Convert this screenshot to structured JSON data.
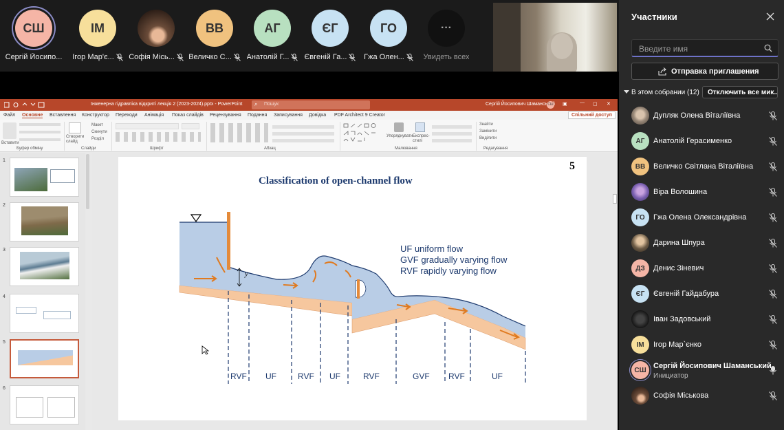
{
  "strip": {
    "tiles": [
      {
        "initials": "СШ",
        "name": "Сергій Йосипо...",
        "bg": "#f5b5a6",
        "muted": false,
        "ring": true
      },
      {
        "initials": "ІМ",
        "name": "Ігор Мар'є...",
        "bg": "#f7df9b",
        "muted": true
      },
      {
        "initials": "",
        "name": "Софія Місь...",
        "bg": "#6b4c39",
        "muted": true,
        "photo": true
      },
      {
        "initials": "ВВ",
        "name": "Величко С...",
        "bg": "#f0c27f",
        "muted": true
      },
      {
        "initials": "АГ",
        "name": "Анатолій Г...",
        "bg": "#b8e0c0",
        "muted": true
      },
      {
        "initials": "ЄГ",
        "name": "Євгеній Га...",
        "bg": "#c7e2f3",
        "muted": true
      },
      {
        "initials": "ГО",
        "name": "Гжа Олен...",
        "bg": "#c7e2f3",
        "muted": true
      }
    ],
    "more_icon": "more-icon",
    "more_label": "Увидеть всех"
  },
  "ppt": {
    "title_file": "Інженерна гідравліка відкриті лекція 2 (2023-2024).pptx  -  PowerPoint",
    "search_placeholder": "Пошук",
    "user_name": "Сергій Йосипович Шаманський",
    "user_initials": "СШ",
    "share_label": "Спільний доступ",
    "menu": [
      "Файл",
      "Основне",
      "Вставлення",
      "Конструктор",
      "Переходи",
      "Анімація",
      "Показ слайдів",
      "Рецензування",
      "Подання",
      "Записування",
      "Довідка",
      "PDF Architect 9 Creator"
    ],
    "ribbon_groups": [
      "Буфер обміну",
      "Слайди",
      "Шрифт",
      "Абзац",
      "Малювання",
      "Редагування"
    ],
    "ribbon_items": {
      "paste": "Вставити",
      "new_slide": "Створити слайд",
      "layout": "Макет",
      "reset": "Скинути",
      "section": "Розділ",
      "arrange": "Упорядкувати",
      "styles": "Експрес-стилі",
      "find": "Знайти",
      "replace": "Замінити",
      "select": "Виділити"
    },
    "thumb_numbers": [
      "1",
      "2",
      "3",
      "4",
      "5",
      "6"
    ]
  },
  "slide": {
    "number": "5",
    "title": "Classification of open-channel flow",
    "legend": [
      "UF uniform flow",
      "GVF gradually varying flow",
      "RVF rapidly varying flow"
    ],
    "depth_label": "y",
    "zones": [
      "RVF",
      "UF",
      "RVF",
      "UF",
      "RVF",
      "GVF",
      "RVF",
      "UF"
    ]
  },
  "panel": {
    "title": "Участники",
    "search_placeholder": "Введите имя",
    "invite_label": "Отправка приглашения",
    "section_label": "В этом собрании (12)",
    "mute_all_label": "Отключить все мик...",
    "participants": [
      {
        "initials": "",
        "name": "Дупляк Олена Віталіївна",
        "bg": "#9a8a7a",
        "photo": true,
        "muted": true
      },
      {
        "initials": "АГ",
        "name": "Анатолій Герасименко",
        "bg": "#b8e0c0",
        "muted": true
      },
      {
        "initials": "ВВ",
        "name": "Величко Світлана Віталіївна",
        "bg": "#f0c27f",
        "muted": true
      },
      {
        "initials": "",
        "name": "Віра Волошина",
        "bg": "#7a5fb0",
        "photo": true,
        "muted": true
      },
      {
        "initials": "ГО",
        "name": "Гжа Олена Олександрівна",
        "bg": "#c7e2f3",
        "muted": true
      },
      {
        "initials": "",
        "name": "Дарина Шпура",
        "bg": "#6b5a45",
        "photo": true,
        "muted": true
      },
      {
        "initials": "ДЗ",
        "name": "Денис Зіневич",
        "bg": "#f5b5a6",
        "muted": true
      },
      {
        "initials": "ЄГ",
        "name": "Євгеній Гайдабура",
        "bg": "#c7e2f3",
        "muted": true
      },
      {
        "initials": "",
        "name": "Іван Задовський",
        "bg": "#222222",
        "photo": true,
        "muted": true
      },
      {
        "initials": "ІМ",
        "name": "Ігор Мар`єнко",
        "bg": "#f7df9b",
        "muted": true
      },
      {
        "initials": "СШ",
        "name": "Сергій Йосипович Шаманський",
        "role": "Инициатор",
        "bg": "#f5b5a6",
        "muted": false,
        "ring": true
      },
      {
        "initials": "",
        "name": "Софія Міськова",
        "bg": "#6b4c39",
        "photo": true,
        "muted": true
      }
    ]
  },
  "colors": {
    "ppt_accent": "#b7472a",
    "panel_bg": "#292929",
    "strip_bg": "#1b1b1b",
    "water": "#b9cde6",
    "water_edge": "#1d3a6e",
    "ground": "#f6c79e",
    "arrow": "#e07a1f"
  }
}
